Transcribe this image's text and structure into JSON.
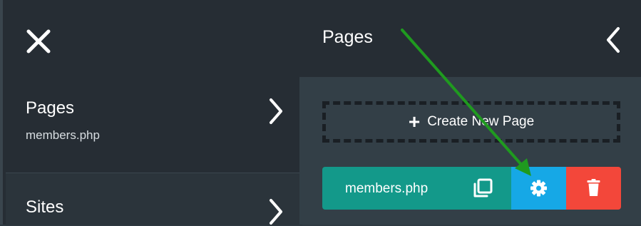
{
  "left_panel": {
    "close_icon": "close-icon",
    "nav": [
      {
        "title": "Pages",
        "subtitle": "members.php",
        "icon": "chevron-right-icon"
      },
      {
        "title": "Sites",
        "icon": "chevron-right-icon"
      }
    ]
  },
  "right_panel": {
    "title": "Pages",
    "back_icon": "chevron-left-icon",
    "create_button": {
      "icon": "plus-icon",
      "label": "Create New Page"
    },
    "pages": [
      {
        "name": "members.php",
        "duplicate_icon": "duplicate-icon",
        "settings_icon": "gear-icon",
        "delete_icon": "trash-icon"
      }
    ]
  },
  "annotation": {
    "arrow_color": "#1f9a1f"
  },
  "colors": {
    "page_row": "#13998a",
    "settings": "#16a8e6",
    "delete": "#f3473a",
    "panel_dark": "#262d34",
    "panel": "#333f47"
  }
}
